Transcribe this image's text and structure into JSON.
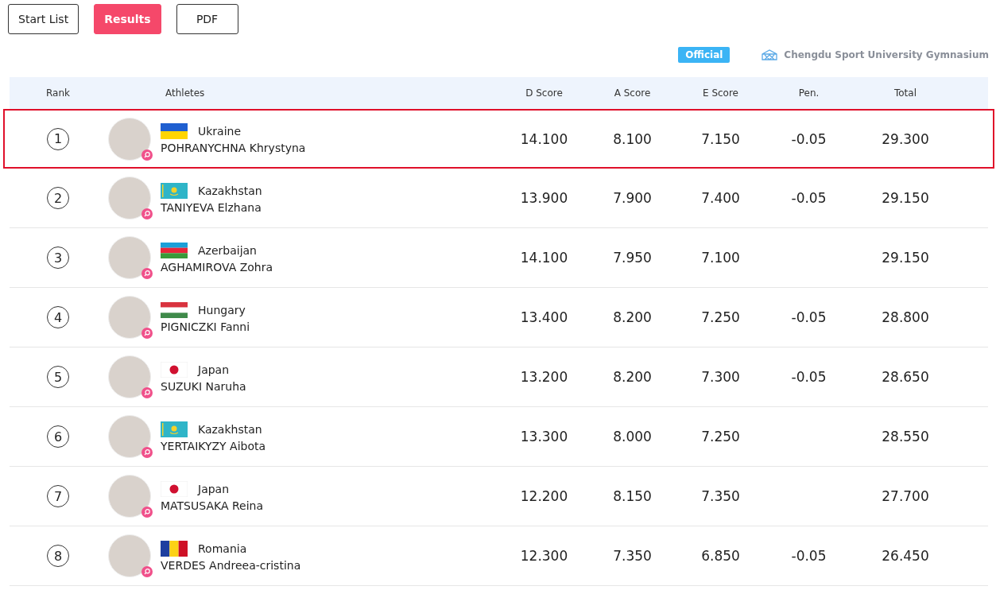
{
  "tabs": [
    {
      "label": "Start List",
      "selected": false
    },
    {
      "label": "Results",
      "selected": true
    },
    {
      "label": "PDF",
      "selected": false
    }
  ],
  "status_badge": "Official",
  "venue": "Chengdu Sport University Gymnasium",
  "table": {
    "columns": [
      "Rank",
      "Athletes",
      "D Score",
      "A Score",
      "E Score",
      "Pen.",
      "Total"
    ],
    "rows": [
      {
        "rank": "1",
        "kind": "ua",
        "country": "Ukraine",
        "name": "POHRANYCHNA Khrystyna",
        "d": "14.100",
        "a": "8.100",
        "e": "7.150",
        "pen": "-0.05",
        "total": "29.300",
        "highlighted": true
      },
      {
        "rank": "2",
        "kind": "kz",
        "country": "Kazakhstan",
        "name": "TANIYEVA Elzhana",
        "d": "13.900",
        "a": "7.900",
        "e": "7.400",
        "pen": "-0.05",
        "total": "29.150",
        "highlighted": false
      },
      {
        "rank": "3",
        "kind": "az",
        "country": "Azerbaijan",
        "name": "AGHAMIROVA Zohra",
        "d": "14.100",
        "a": "7.950",
        "e": "7.100",
        "total": "29.150",
        "highlighted": false
      },
      {
        "rank": "4",
        "kind": "hu",
        "country": "Hungary",
        "name": "PIGNICZKI Fanni",
        "d": "13.400",
        "a": "8.200",
        "e": "7.250",
        "pen": "-0.05",
        "total": "28.800",
        "highlighted": false
      },
      {
        "rank": "5",
        "kind": "jp",
        "country": "Japan",
        "name": "SUZUKI Naruha",
        "d": "13.200",
        "a": "8.200",
        "e": "7.300",
        "pen": "-0.05",
        "total": "28.650",
        "highlighted": false
      },
      {
        "rank": "6",
        "kind": "kz",
        "country": "Kazakhstan",
        "name": "YERTAIKYZY Aibota",
        "d": "13.300",
        "a": "8.000",
        "e": "7.250",
        "total": "28.550",
        "highlighted": false
      },
      {
        "rank": "7",
        "kind": "jp",
        "country": "Japan",
        "name": "MATSUSAKA Reina",
        "d": "12.200",
        "a": "8.150",
        "e": "7.350",
        "total": "27.700",
        "highlighted": false
      },
      {
        "rank": "8",
        "kind": "ro",
        "country": "Romania",
        "name": "VERDES Andreea-cristina",
        "d": "12.300",
        "a": "7.350",
        "e": "6.850",
        "pen": "-0.05",
        "total": "26.450",
        "highlighted": false
      }
    ]
  }
}
